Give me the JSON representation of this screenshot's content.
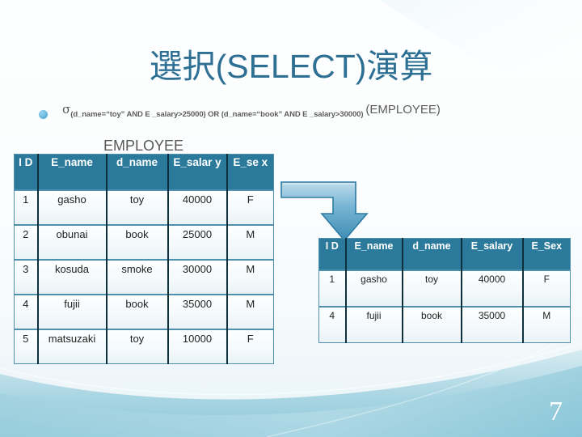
{
  "slide": {
    "title": "選択(SELECT)演算",
    "page_number": "7",
    "accent_color": "#2b7a9c",
    "title_color": "#2e6f94",
    "arrow_color": "#4a9cc0",
    "bullet_color": "#63b6dd"
  },
  "formula": {
    "bullet": "bullet-dot",
    "operator": "σ",
    "condition": "(d_name=“toy” AND E _salary>25000)  OR  (d_name=“book” AND E _salary>30000)",
    "relation": "(EMPLOYEE)"
  },
  "employee_table": {
    "caption": "EMPLOYEE",
    "columns": [
      "I D",
      "E_name",
      "d_name",
      "E_salar y",
      "E_se x"
    ],
    "rows": [
      [
        "1",
        "gasho",
        "toy",
        "40000",
        "F"
      ],
      [
        "2",
        "obunai",
        "book",
        "25000",
        "M"
      ],
      [
        "3",
        "kosuda",
        "smoke",
        "30000",
        "M"
      ],
      [
        "4",
        "fujii",
        "book",
        "35000",
        "M"
      ],
      [
        "5",
        "matsuzaki",
        "toy",
        "10000",
        "F"
      ]
    ]
  },
  "result_table": {
    "columns": [
      "I D",
      "E_name",
      "d_name",
      "E_salary",
      "E_Sex"
    ],
    "rows": [
      [
        "1",
        "gasho",
        "toy",
        "40000",
        "F"
      ],
      [
        "4",
        "fujii",
        "book",
        "35000",
        "M"
      ]
    ]
  },
  "arrow": {
    "name": "elbow-arrow-right-down"
  }
}
